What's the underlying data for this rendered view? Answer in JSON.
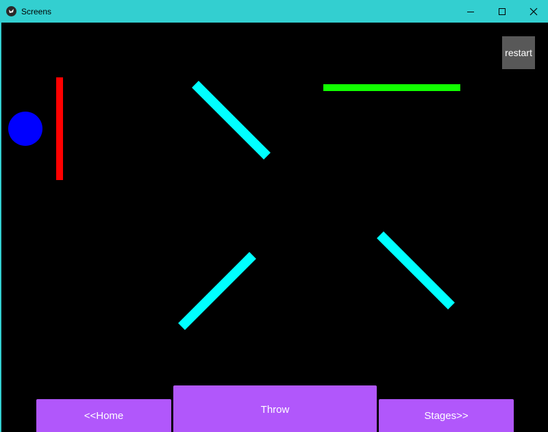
{
  "window": {
    "title": "Screens",
    "titlebar_color": "#33cfd0",
    "controls": {
      "minimize_icon": "minimize-icon",
      "maximize_icon": "maximize-icon",
      "close_icon": "close-icon"
    }
  },
  "game": {
    "background_color": "#000000",
    "ball_color": "#0000ff",
    "red_wall_color": "#ff0000",
    "deflector_color": "#00ffff",
    "target_color": "#11ff00"
  },
  "toolbar": {
    "restart_label": "restart",
    "home_label": "<<Home",
    "throw_label": "Throw",
    "stages_label": "Stages>>",
    "button_color": "#b157fb"
  }
}
